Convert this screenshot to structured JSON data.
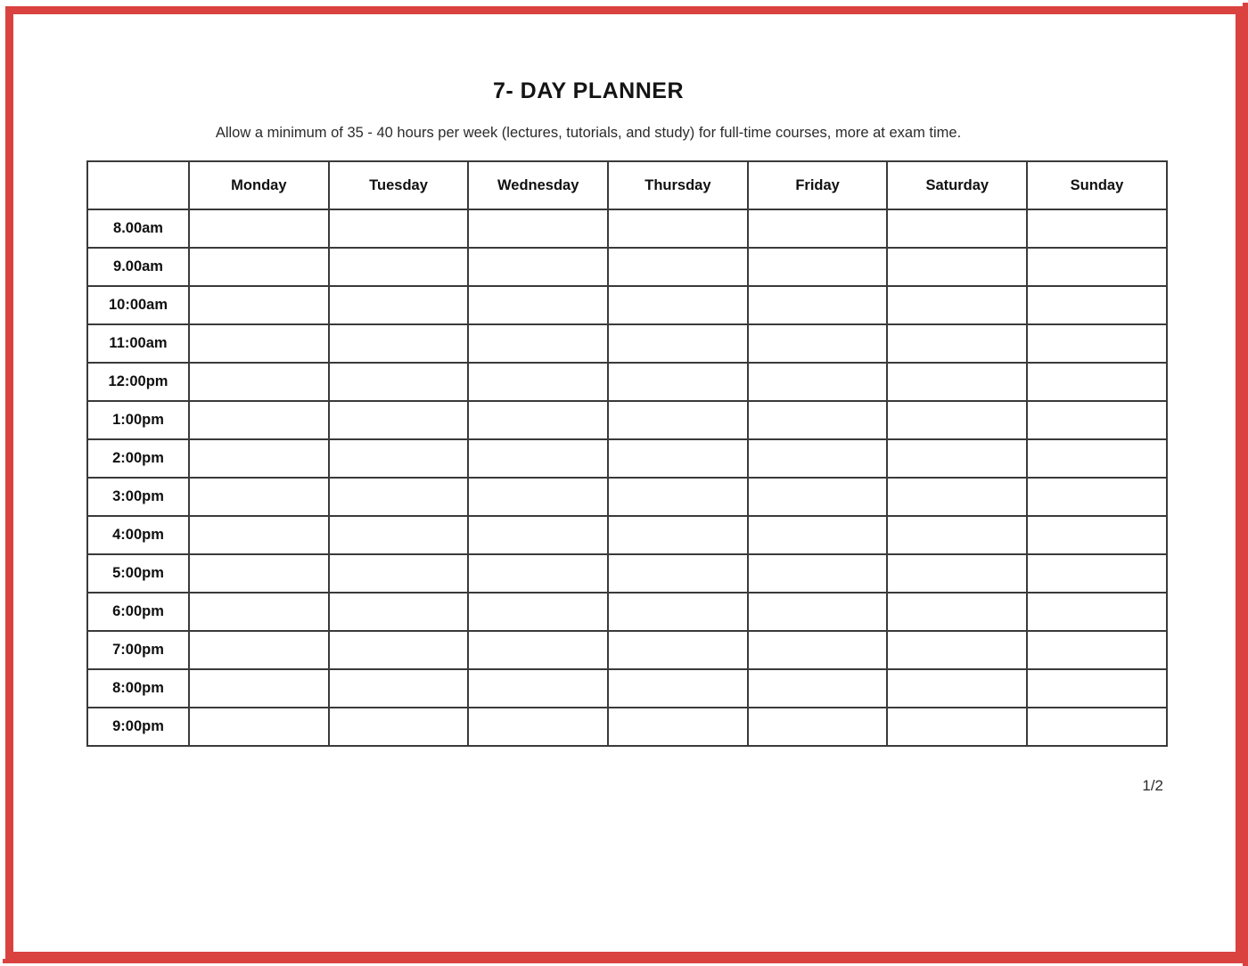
{
  "document": {
    "title": "7- DAY PLANNER",
    "subtitle": "Allow a minimum of 35 - 40 hours per week (lectures, tutorials, and study) for full-time courses, more at exam time.",
    "page_indicator": "1/2"
  },
  "theme": {
    "border_color": "#d9423f",
    "grid_color": "#3a3a3a",
    "text_color": "#101010",
    "page_background": "#ffffff"
  },
  "table": {
    "corner_header": "",
    "day_headers": [
      "Monday",
      "Tuesday",
      "Wednesday",
      "Thursday",
      "Friday",
      "Saturday",
      "Sunday"
    ],
    "time_labels": [
      "8.00am",
      "9.00am",
      "10:00am",
      "11:00am",
      "12:00pm",
      "1:00pm",
      "2:00pm",
      "3:00pm",
      "4:00pm",
      "5:00pm",
      "6:00pm",
      "7:00pm",
      "8:00pm",
      "9:00pm"
    ],
    "cells": [
      [
        "",
        "",
        "",
        "",
        "",
        "",
        ""
      ],
      [
        "",
        "",
        "",
        "",
        "",
        "",
        ""
      ],
      [
        "",
        "",
        "",
        "",
        "",
        "",
        ""
      ],
      [
        "",
        "",
        "",
        "",
        "",
        "",
        ""
      ],
      [
        "",
        "",
        "",
        "",
        "",
        "",
        ""
      ],
      [
        "",
        "",
        "",
        "",
        "",
        "",
        ""
      ],
      [
        "",
        "",
        "",
        "",
        "",
        "",
        ""
      ],
      [
        "",
        "",
        "",
        "",
        "",
        "",
        ""
      ],
      [
        "",
        "",
        "",
        "",
        "",
        "",
        ""
      ],
      [
        "",
        "",
        "",
        "",
        "",
        "",
        ""
      ],
      [
        "",
        "",
        "",
        "",
        "",
        "",
        ""
      ],
      [
        "",
        "",
        "",
        "",
        "",
        "",
        ""
      ],
      [
        "",
        "",
        "",
        "",
        "",
        "",
        ""
      ],
      [
        "",
        "",
        "",
        "",
        "",
        "",
        ""
      ]
    ]
  }
}
